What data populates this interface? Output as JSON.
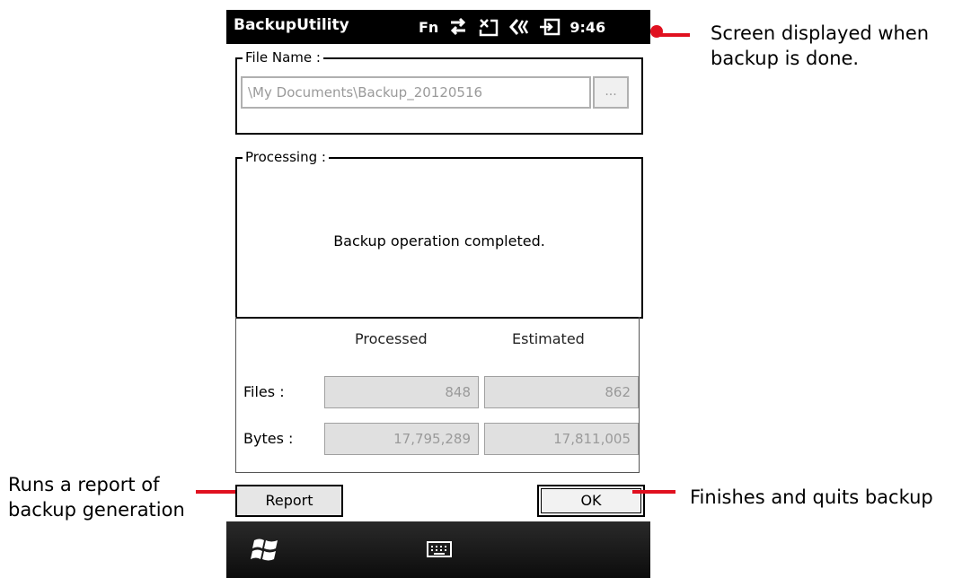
{
  "window": {
    "title": "BackupUtility"
  },
  "status_bar": {
    "fn_label": "Fn",
    "time": "9:46",
    "icons": [
      "sync-arrows-icon",
      "no-signal-icon",
      "speaker-icon",
      "battery-charging-icon"
    ]
  },
  "file_name": {
    "legend": "File Name :",
    "path": "\\My Documents\\Backup_20120516",
    "browse_label": "..."
  },
  "processing": {
    "legend": "Processing :",
    "message": "Backup operation completed."
  },
  "stats": {
    "col_processed": "Processed",
    "col_estimated": "Estimated",
    "files_label": "Files :",
    "bytes_label": "Bytes :",
    "files_processed": "848",
    "files_estimated": "862",
    "bytes_processed": "17,795,289",
    "bytes_estimated": "17,811,005"
  },
  "buttons": {
    "report": "Report",
    "ok": "OK"
  },
  "taskbar": {
    "icons": [
      "windows-start-icon",
      "keyboard-icon"
    ]
  },
  "annotations": {
    "screen_done": [
      "Screen displayed when",
      "backup is done."
    ],
    "report": [
      "Runs a report of",
      "backup generation"
    ],
    "ok": "Finishes and quits backup"
  },
  "colors": {
    "annotation_line": "#e0101f",
    "titlebar": "#000000"
  }
}
